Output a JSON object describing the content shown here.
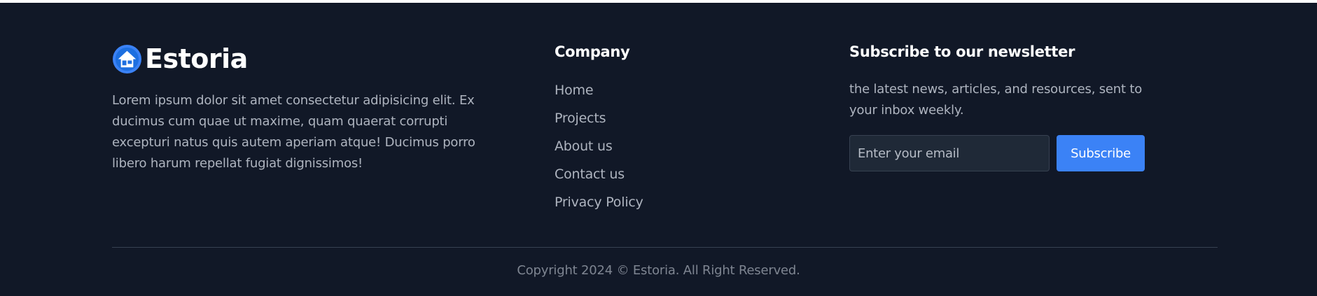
{
  "brand": {
    "name": "Estoria",
    "logo_icon": "house-icon",
    "description": "Lorem ipsum dolor sit amet consectetur adipisicing elit. Ex ducimus cum quae ut maxime, quam quaerat corrupti excepturi natus quis autem aperiam atque! Ducimus porro libero harum repellat fugiat dignissimos!"
  },
  "company": {
    "title": "Company",
    "links": [
      {
        "label": "Home"
      },
      {
        "label": "Projects"
      },
      {
        "label": "About us"
      },
      {
        "label": "Contact us"
      },
      {
        "label": "Privacy Policy"
      }
    ]
  },
  "newsletter": {
    "title": "Subscribe to our newsletter",
    "description": "the latest news, articles, and resources, sent to your inbox weekly.",
    "email_placeholder": "Enter your email",
    "email_value": "",
    "button_label": "Subscribe"
  },
  "copyright": "Copyright 2024 © Estoria. All Right Reserved.",
  "colors": {
    "background": "#111827",
    "accent": "#3b82f6",
    "text_muted": "#aeb4bf",
    "heading": "#ffffff"
  }
}
